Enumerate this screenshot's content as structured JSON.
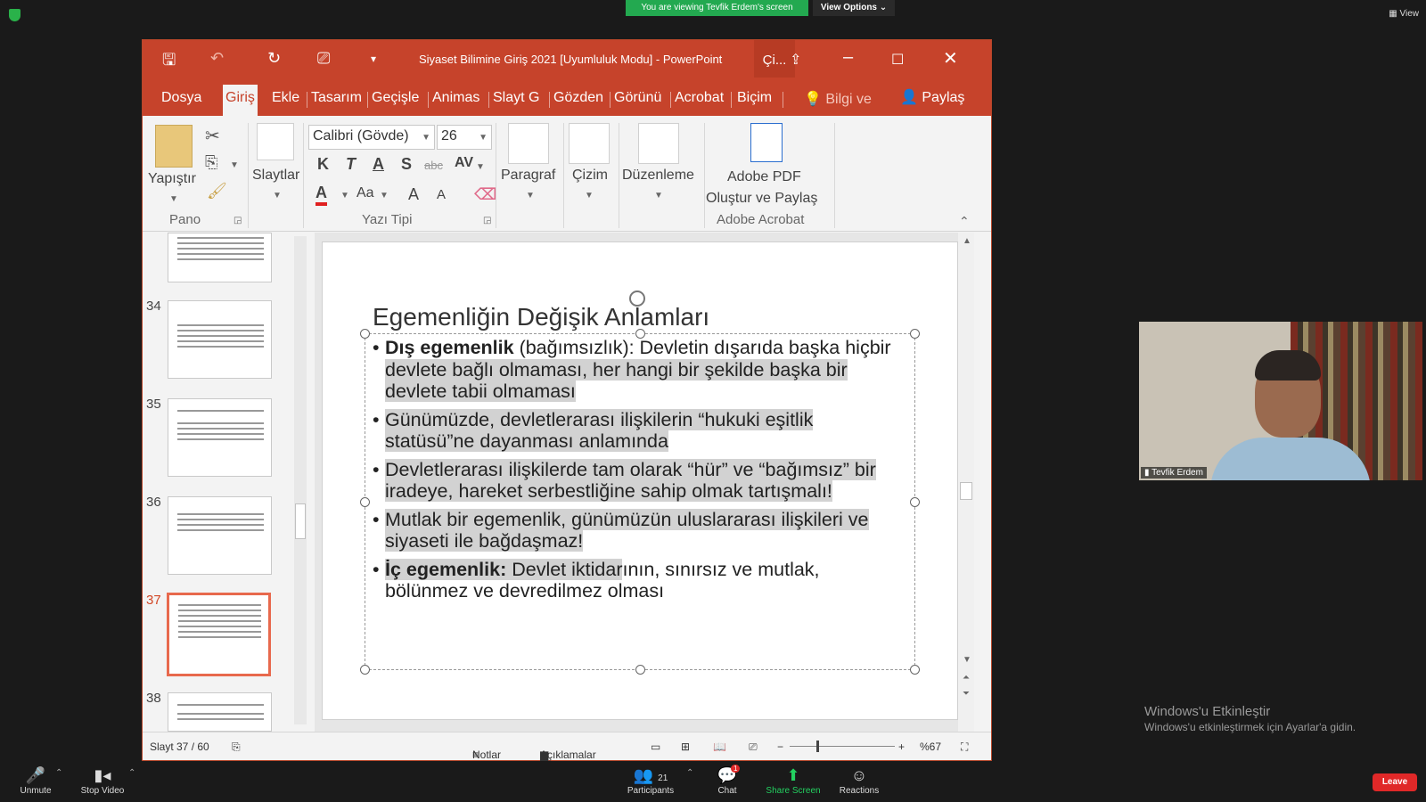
{
  "zoom": {
    "banner": "You are viewing Tevfik Erdem's screen",
    "view_options": "View Options ⌄",
    "view_top": "View",
    "participant_name": "Tevfik Erdem",
    "bottom": {
      "unmute": "Unmute",
      "stop_video": "Stop Video",
      "participants": "Participants",
      "participants_count": "21",
      "chat": "Chat",
      "chat_badge": "1",
      "share_screen": "Share Screen",
      "reactions": "Reactions",
      "leave": "Leave"
    }
  },
  "windows_activate": {
    "title": "Windows'u Etkinleştir",
    "subtitle": "Windows'u etkinleştirmek için Ayarlar'a gidin."
  },
  "ppt": {
    "title": "Siyaset Bilimine Giriş 2021 [Uyumluluk Modu] - PowerPoint",
    "title_extra": "Çi...",
    "tabs": [
      "Dosya",
      "Giriş",
      "Ekle",
      "Tasarım",
      "Geçişle",
      "Animas",
      "Slayt G",
      "Gözden",
      "Görünü",
      "Acrobat",
      "Biçim"
    ],
    "tell_me": "Bilgi ve",
    "share": "Paylaş",
    "ribbon": {
      "paste": "Yapıştır",
      "clipboard_group": "Pano",
      "slides": "Slaytlar",
      "font_name": "Calibri (Gövde)",
      "font_size": "26",
      "bold": "K",
      "italic": "T",
      "underline": "A",
      "shadow": "S",
      "strike": "abc",
      "spacing": "AV",
      "font_color": "A",
      "case": "Aa",
      "grow": "A",
      "shrink": "A",
      "font_group": "Yazı Tipi",
      "paragraph": "Paragraf",
      "drawing": "Çizim",
      "editing": "Düzenleme",
      "adobe_line1": "Adobe PDF",
      "adobe_line2": "Oluştur ve Paylaş",
      "adobe_group": "Adobe Acrobat"
    },
    "thumbnails": [
      {
        "num": "",
        "lines": 6
      },
      {
        "num": "34",
        "lines": 5
      },
      {
        "num": "35",
        "lines": 5
      },
      {
        "num": "36",
        "lines": 4
      },
      {
        "num": "37",
        "lines": 7
      },
      {
        "num": "38",
        "lines": 3
      }
    ],
    "slide": {
      "title": "Egemenliğin Değişik Anlamları",
      "b1_bold": "Dış egemenlik",
      "b1_a": " (bağımsızlık): Devletin dışarıda başka hiçbir ",
      "b1_hl": "devlete bağlı olmaması, her hangi bir şekilde başka bir devlete tabii olmaması",
      "b2": "Günümüzde, devletlerarası ilişkilerin “hukuki eşitlik statüsü”ne dayanması anlamında",
      "b3": "Devletlerarası ilişkilerde tam olarak “hür” ve “bağımsız” bir iradeye, hareket serbestliğine sahip olmak tartışmalı!",
      "b4": "Mutlak bir egemenlik, günümüzün uluslararası ilişkileri ve siyaseti ile bağdaşmaz!",
      "b5_bold": "İç egemenlik:",
      "b5_hl": " Devlet iktidar",
      "b5_rest": "ının, sınırsız ve mutlak, bölünmez ve devredilmez olması"
    },
    "status": {
      "slide_count": "Slayt 37 / 60",
      "notes": "Notlar",
      "comments": "Açıklamalar",
      "zoom_level": "%67"
    },
    "colors": {
      "accent": "#c6432b",
      "selected_thumb": "#e8694d"
    }
  }
}
